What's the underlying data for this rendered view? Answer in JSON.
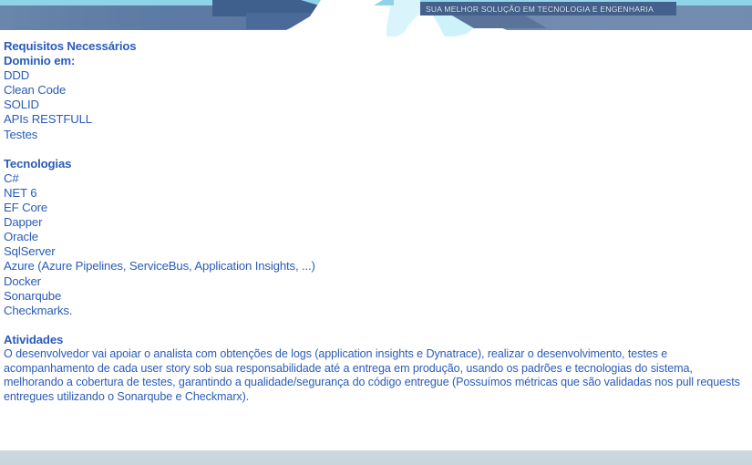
{
  "header": {
    "tagline": "SUA MELHOR SOLUÇÃO EM TECNOLOGIA E ENGENHARIA",
    "colors": {
      "top_strip": "#8fd3e8",
      "slate_band": "#5d7ba3",
      "dark_chevron": "#3f5f8d",
      "pale_cyan": "#cdf2f9",
      "muted_blue": "#6b87ab"
    }
  },
  "sections": {
    "requisitos": {
      "heading": "Requisitos Necessários",
      "subheading": "Dominio em:",
      "items": [
        "DDD",
        "Clean Code",
        "SOLID",
        "APIs RESTFULL",
        "Testes"
      ]
    },
    "tecnologias": {
      "heading": "Tecnologias",
      "items": [
        "C#",
        "NET 6",
        "EF Core",
        "Dapper",
        "Oracle",
        "SqlServer",
        "Azure (Azure Pipelines,  ServiceBus, Application Insights, ...)",
        "Docker",
        "Sonarqube",
        "Checkmarks."
      ]
    },
    "atividades": {
      "heading": "Atividades",
      "body": "O desenvolvedor vai apoiar o analista com obtenções de logs (application insights e Dynatrace), realizar o desenvolvimento, testes e acompanhamento de cada user story sob sua responsabilidade até a entrega em produção, usando os padrões e tecnologias do sistema, melhorando a cobertura de testes, garantindo a qualidade/segurança do código entregue (Possuímos métricas que são validadas nos pull requests entregues utilizando o Sonarqube e Checkmarx)."
    }
  },
  "footer": {
    "color": "#ccd7de"
  },
  "text_color": "#2a5cb8"
}
